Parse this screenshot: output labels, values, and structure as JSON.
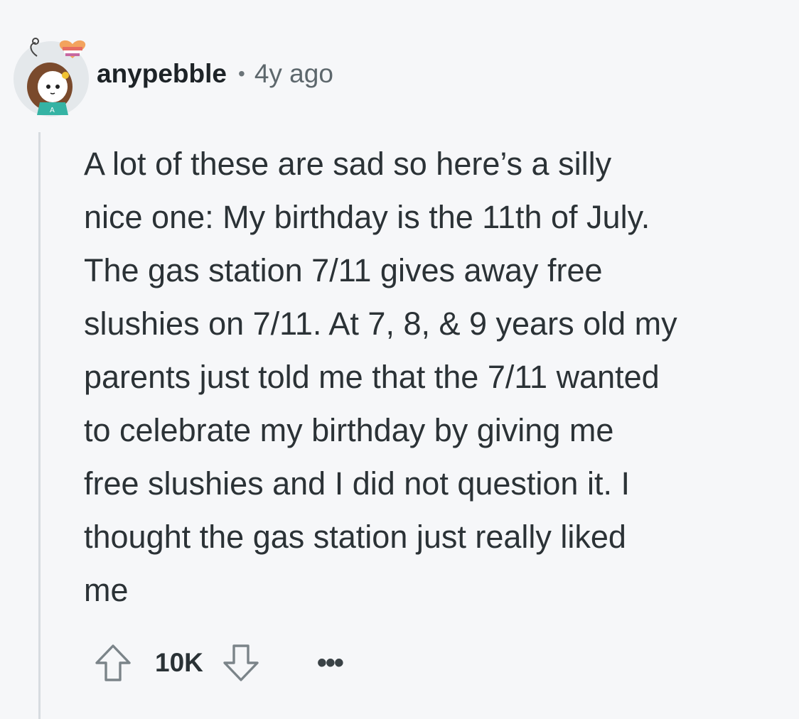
{
  "comment": {
    "username": "anypebble",
    "separator": "•",
    "timestamp": "4y ago",
    "body_lines": [
      "A lot of these are sad so here’s a silly",
      "nice one: My birthday is the 11th of July.",
      "The gas station 7/11 gives away free",
      "slushies on 7/11. At 7, 8, & 9 years old my",
      "parents just told me that the 7/11 wanted",
      "to celebrate my birthday by giving me",
      "free slushies and I did not question it. I",
      "thought the gas station just really liked",
      "me"
    ],
    "score": "10K",
    "more_label": "•••"
  },
  "icons": {
    "avatar": "user-avatar-drawing",
    "flair": "heart-flag-icon",
    "upvote": "upvote-arrow-icon",
    "downvote": "downvote-arrow-icon",
    "more": "ellipsis-icon"
  },
  "colors": {
    "background": "#f6f7f9",
    "text": "#2b3236",
    "muted": "#5d676c",
    "thread_line": "#d7dce0"
  }
}
